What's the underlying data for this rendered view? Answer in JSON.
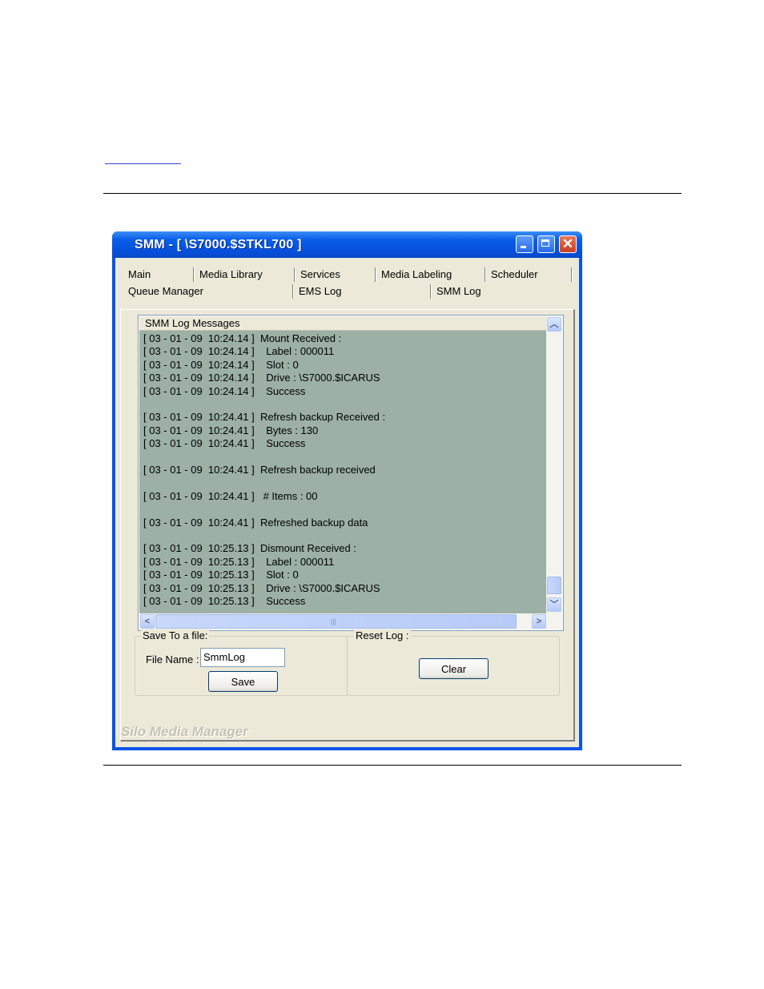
{
  "window": {
    "title": "SMM - [ \\S7000.$STKL700 ]",
    "footer_brand": "Silo Media Manager"
  },
  "tabs": {
    "row1": [
      "Main",
      "Media Library",
      "Services",
      "Media Labeling",
      "Scheduler"
    ],
    "row2": [
      "Queue Manager",
      "EMS Log",
      "SMM Log"
    ],
    "active": "SMM Log"
  },
  "log": {
    "header": "SMM Log Messages",
    "lines": [
      "[ 03 - 01 - 09  10:24.14 ]  Mount Received :",
      "[ 03 - 01 - 09  10:24.14 ]    Label : 000011",
      "[ 03 - 01 - 09  10:24.14 ]    Slot : 0",
      "[ 03 - 01 - 09  10:24.14 ]    Drive : \\S7000.$ICARUS",
      "[ 03 - 01 - 09  10:24.14 ]    Success",
      "",
      "[ 03 - 01 - 09  10:24.41 ]  Refresh backup Received :",
      "[ 03 - 01 - 09  10:24.41 ]    Bytes : 130",
      "[ 03 - 01 - 09  10:24.41 ]    Success",
      "",
      "[ 03 - 01 - 09  10:24.41 ]  Refresh backup received",
      "",
      "[ 03 - 01 - 09  10:24.41 ]   # Items : 00",
      "",
      "[ 03 - 01 - 09  10:24.41 ]  Refreshed backup data",
      "",
      "[ 03 - 01 - 09  10:25.13 ]  Dismount Received :",
      "[ 03 - 01 - 09  10:25.13 ]    Label : 000011",
      "[ 03 - 01 - 09  10:25.13 ]    Slot : 0",
      "[ 03 - 01 - 09  10:25.13 ]    Drive : \\S7000.$ICARUS",
      "[ 03 - 01 - 09  10:25.13 ]    Success"
    ]
  },
  "save_group": {
    "label": "Save To a file:",
    "file_name_label": "File Name :",
    "file_name_value": "SmmLog",
    "save_button": "Save"
  },
  "reset_group": {
    "label": "Reset Log :",
    "clear_button": "Clear"
  },
  "colors": {
    "titlebar": "#0a54e6",
    "log_background": "#9cb0a6",
    "dialog_face": "#ece9d8"
  }
}
